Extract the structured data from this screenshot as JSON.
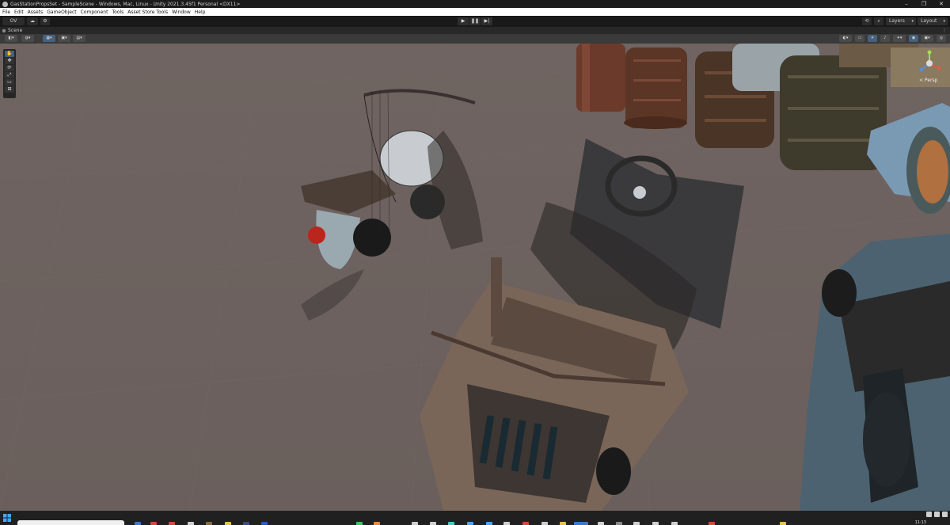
{
  "window": {
    "title": "GasStationPropsSet - SampleScene - Windows, Mac, Linux - Unity 2021.3.45f1 Personal <DX11>",
    "minimize": "–",
    "maximize": "❐",
    "close": "✕"
  },
  "menu": {
    "items": [
      "File",
      "Edit",
      "Assets",
      "GameObject",
      "Component",
      "Tools",
      "Asset Store Tools",
      "Window",
      "Help"
    ]
  },
  "toolbar": {
    "account_label": "OV",
    "play_icon": "▶",
    "pause_icon": "❚❚",
    "step_icon": "▶|",
    "layers_label": "Layers",
    "layout_label": "Layout"
  },
  "scene": {
    "tab_label": "Scene",
    "kebab": "⋮",
    "persp_label": "< Persp"
  },
  "tools": [
    "hand-tool",
    "move-tool",
    "rotate-tool",
    "scale-tool",
    "rect-tool",
    "transform-tool"
  ],
  "taskbar": {
    "clock": "11:13"
  },
  "colors": {
    "viewport_bg": "#6e6260",
    "accent": "#46607f"
  }
}
